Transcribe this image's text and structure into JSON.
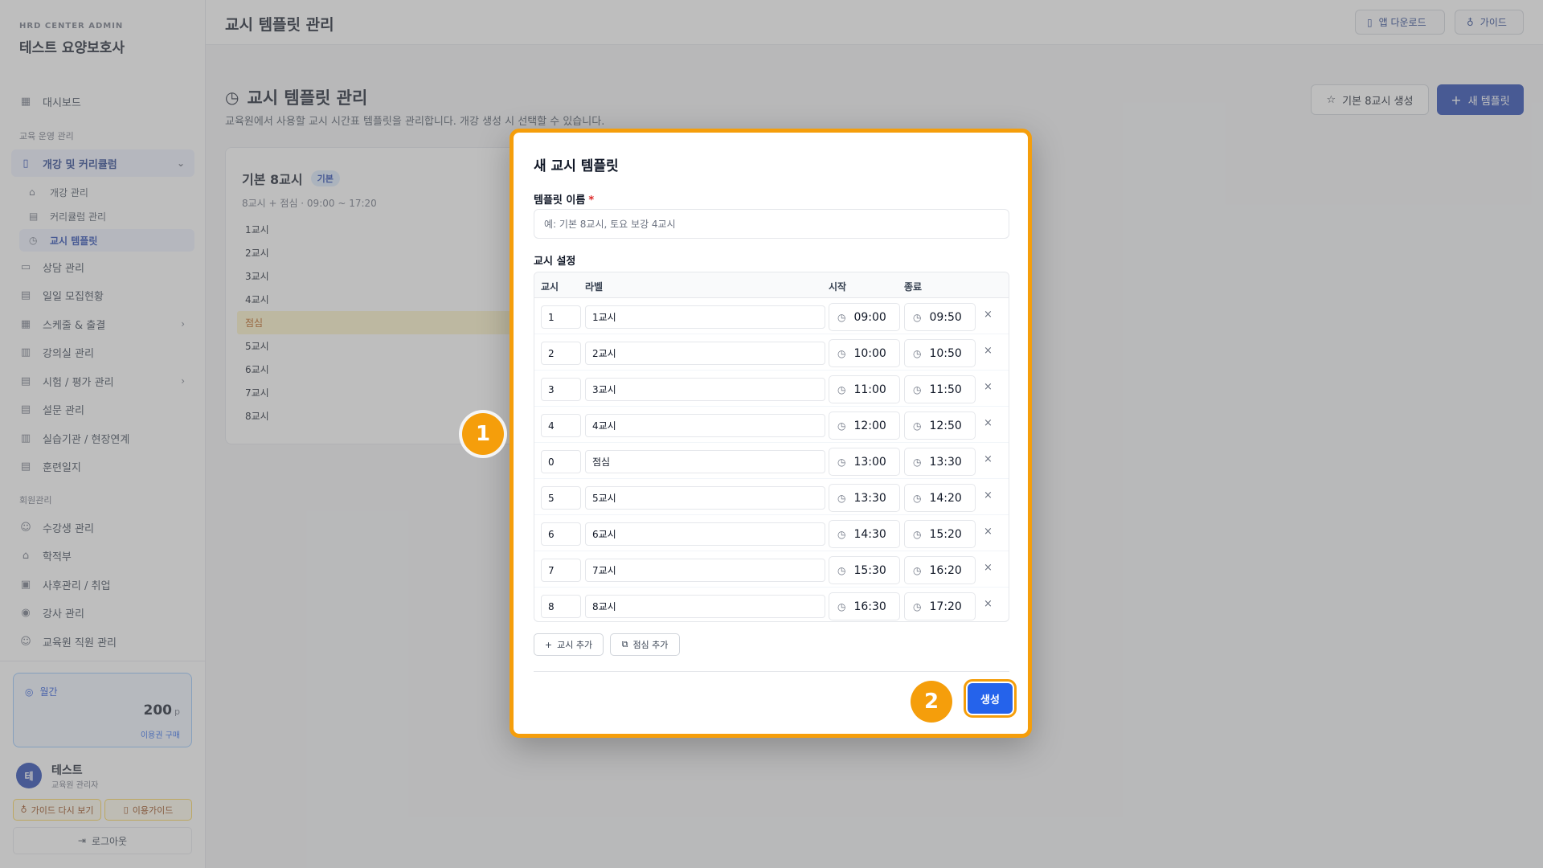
{
  "sidebar": {
    "brand_small": "HRD CENTER ADMIN",
    "brand_title": "테스트 요양보호사",
    "dashboard": "대시보드",
    "section_edu": "교육 운영 관리",
    "course_curriculum": "개강 및 커리큘럼",
    "sub_course": "개강 관리",
    "sub_curriculum": "커리큘럼 관리",
    "sub_template": "교시 템플릿",
    "consult": "상담 관리",
    "daily_recruit": "일일 모집현황",
    "schedule": "스케줄 & 출결",
    "classroom": "강의실 관리",
    "exam": "시험 / 평가 관리",
    "survey": "설문 관리",
    "practice": "실습기관 / 현장연계",
    "training_log": "훈련일지",
    "section_member": "회원관리",
    "students": "수강생 관리",
    "registry": "학적부",
    "aftercare": "사후관리 / 취업",
    "instructors": "강사 관리",
    "staff": "교육원 직원 관리",
    "points_label": "월간",
    "points_value": "200",
    "points_unit": "p",
    "points_link": "이용권 구매",
    "user_initial": "테",
    "user_name": "테스트",
    "user_role": "교육원 관리자",
    "guide_again": "가이드 다시 보기",
    "usage_guide": "이용가이드",
    "logout": "로그아웃"
  },
  "topbar": {
    "title": "교시 템플릿 관리",
    "app_download": "앱 다운로드",
    "guide": "가이드"
  },
  "main": {
    "page_title": "교시 템플릿 관리",
    "page_desc": "교육원에서 사용할 교시 시간표 템플릿을 관리합니다. 개강 생성 시 선택할 수 있습니다.",
    "btn_basic": "기본 8교시 생성",
    "btn_new": "새 템플릿",
    "card": {
      "title": "기본 8교시",
      "badge": "기본",
      "sub": "8교시 + 점심 · 09:00 ~ 17:20",
      "rows": [
        "1교시",
        "2교시",
        "3교시",
        "4교시",
        "점심",
        "5교시",
        "6교시",
        "7교시",
        "8교시"
      ]
    }
  },
  "modal": {
    "title": "새 교시 템플릿",
    "name_label": "템플릿 이름",
    "name_required": "*",
    "name_placeholder": "예: 기본 8교시, 토요 보강 4교시",
    "name_value": "",
    "period_label": "교시 설정",
    "col_period": "교시",
    "col_label": "라벨",
    "col_start": "시작",
    "col_end": "종료",
    "rows": [
      {
        "num": "1",
        "label": "1교시",
        "start": "09:00",
        "end": "09:50"
      },
      {
        "num": "2",
        "label": "2교시",
        "start": "10:00",
        "end": "10:50"
      },
      {
        "num": "3",
        "label": "3교시",
        "start": "11:00",
        "end": "11:50"
      },
      {
        "num": "4",
        "label": "4교시",
        "start": "12:00",
        "end": "12:50"
      },
      {
        "num": "0",
        "label": "점심",
        "start": "13:00",
        "end": "13:30"
      },
      {
        "num": "5",
        "label": "5교시",
        "start": "13:30",
        "end": "14:20"
      },
      {
        "num": "6",
        "label": "6교시",
        "start": "14:30",
        "end": "15:20"
      },
      {
        "num": "7",
        "label": "7교시",
        "start": "15:30",
        "end": "16:20"
      },
      {
        "num": "8",
        "label": "8교시",
        "start": "16:30",
        "end": "17:20"
      }
    ],
    "add_period": "교시 추가",
    "add_lunch": "점심 추가",
    "create": "생성"
  },
  "markers": {
    "step1": "1",
    "step2": "2"
  },
  "colors": {
    "accent": "#1e40af",
    "highlight": "#f59e0b",
    "primary_button": "#2563eb"
  }
}
